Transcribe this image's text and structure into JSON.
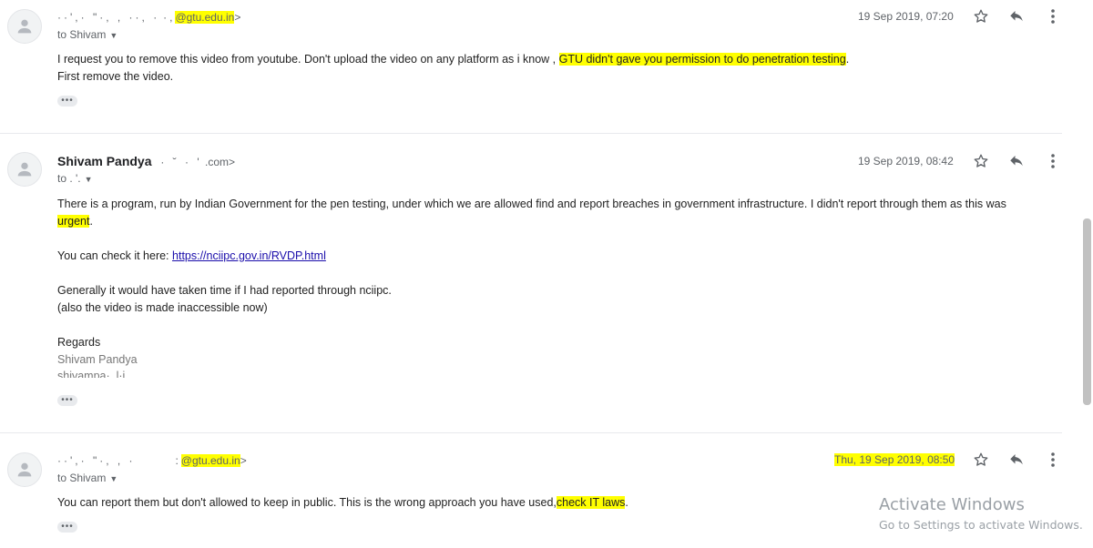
{
  "messages": [
    {
      "sender_name": "",
      "sender_prefix": "··',·  \"·,  ,   ··, ·",
      "sender_email_visible": "@gtu.edu.in",
      "sender_suffix": ">",
      "to_label": "to Shivam",
      "date": "19 Sep 2019, 07:20",
      "body": [
        {
          "pre": "I request you to remove this video from youtube. Don't upload the video on any platform as i know ,",
          "hl": "GTU didn't gave you permission to do penetration testing",
          "post": "."
        },
        {
          "text": "First remove the video."
        }
      ],
      "more_label": "•••"
    },
    {
      "sender_name": "Shivam Pandya",
      "sender_prefix": "·      ˘      ·      '",
      "sender_email_visible": ".com",
      "sender_suffix": ">",
      "to_label": "to .      '.",
      "date": "19 Sep 2019, 08:42",
      "body": {
        "para1_pre": "There is a program, run by Indian Government for the pen testing, under which we are allowed find and report breaches in government infrastructure. I didn't report through them as this was",
        "para1_hl": "urgent",
        "para1_post": ".",
        "check_pre": "You can check it here: ",
        "check_link": "https://nciipc.gov.in/RVDP.html",
        "line3": "Generally it would have taken time if I had reported through nciipc.",
        "line4": "(also the video is made inaccessible now)",
        "regards": "Regards",
        "sig_name": "Shivam Pandya",
        "sig_partial": "shivampa·..l·j"
      },
      "more_label": "•••"
    },
    {
      "sender_name": "",
      "sender_prefix": "··',·  \"·,  ,    ·",
      "sender_email_visible": "@gtu.edu.in",
      "sender_suffix": ">",
      "to_label": "to Shivam",
      "date": "Thu, 19 Sep 2019, 08:50",
      "body": [
        {
          "pre": "You can report them but don't allowed to keep in public. This is the wrong approach you have used,",
          "hl": "check IT laws",
          "post": "."
        }
      ],
      "more_label": "•••"
    }
  ],
  "icons": [
    "person-icon",
    "star-icon",
    "reply-icon",
    "more-vert-icon"
  ],
  "watermark": {
    "line1": "Activate Windows",
    "line2": "Go to Settings to activate Windows."
  },
  "colors": {
    "highlight": "#ffff00",
    "link": "#1a0dab",
    "meta_text": "#5f6368",
    "divider": "#e8eaed"
  }
}
